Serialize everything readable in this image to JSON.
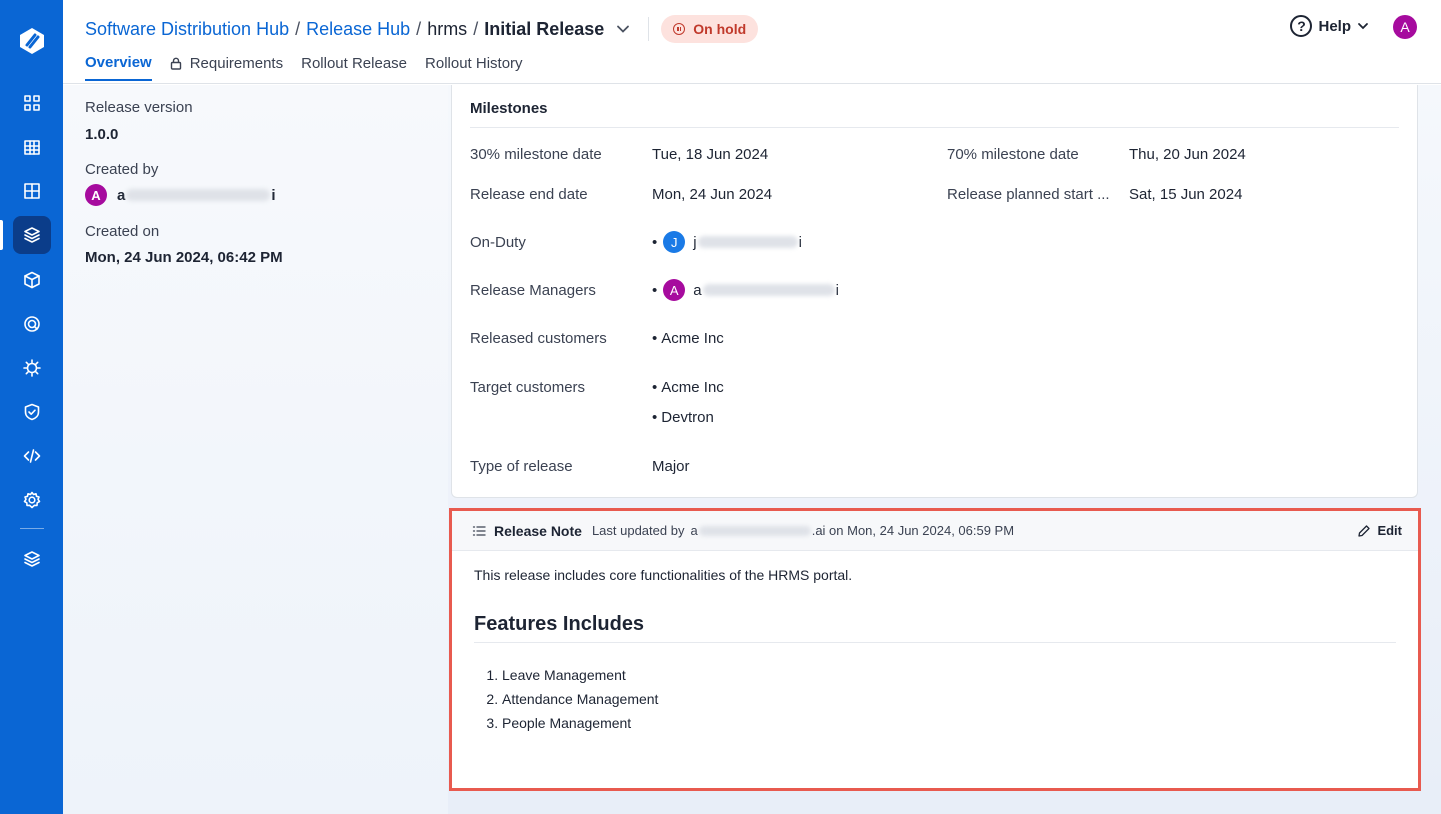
{
  "breadcrumb": {
    "root": "Software Distribution Hub",
    "hub": "Release Hub",
    "app": "hrms",
    "current": "Initial Release"
  },
  "status": {
    "label": "On hold",
    "color": "#c0392b"
  },
  "tabs": [
    {
      "label": "Overview",
      "active": true
    },
    {
      "label": "Requirements",
      "icon": "lock-icon"
    },
    {
      "label": "Rollout Release"
    },
    {
      "label": "Rollout History"
    }
  ],
  "help": {
    "label": "Help"
  },
  "user": {
    "initial": "A"
  },
  "details": {
    "version_label": "Release version",
    "version_value": "1.0.0",
    "created_by_label": "Created by",
    "created_by_initial": "A",
    "created_by_prefix": "a",
    "created_by_suffix": "i",
    "created_on_label": "Created on",
    "created_on_value": "Mon, 24 Jun 2024, 06:42 PM"
  },
  "milestones": {
    "title": "Milestones",
    "m30_label": "30% milestone date",
    "m30_value": "Tue, 18 Jun 2024",
    "m70_label": "70% milestone date",
    "m70_value": "Thu, 20 Jun 2024",
    "end_label": "Release end date",
    "end_value": "Mon, 24 Jun 2024",
    "start_label": "Release planned start ...",
    "start_value": "Sat, 15 Jun 2024",
    "onduty_label": "On-Duty",
    "onduty_initial": "J",
    "onduty_prefix": "j",
    "onduty_suffix": "i",
    "managers_label": "Release Managers",
    "managers_initial": "A",
    "managers_prefix": "a",
    "managers_suffix": "i",
    "released_label": "Released customers",
    "released_value": "Acme Inc",
    "target_label": "Target customers",
    "target_values": [
      "Acme Inc",
      "Devtron"
    ],
    "type_label": "Type of release",
    "type_value": "Major"
  },
  "release_note": {
    "title": "Release Note",
    "updated_prefix": "Last updated by",
    "updated_user_prefix": "a",
    "updated_suffix": ".ai on Mon, 24 Jun 2024, 06:59 PM",
    "edit_label": "Edit",
    "paragraph": "This release includes core functionalities of the HRMS portal.",
    "heading": "Features Includes",
    "items": [
      "Leave Management",
      "Attendance Management",
      "People Management"
    ]
  },
  "colors": {
    "sidebar": "#0a66d4",
    "accent": "#0a66d4",
    "highlight": "#e85a4f"
  }
}
